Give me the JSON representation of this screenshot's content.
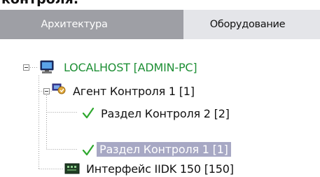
{
  "tabs": [
    {
      "label": "Архитектура",
      "active": false
    },
    {
      "label": "Оборудование",
      "active": true
    }
  ],
  "tree": {
    "root": {
      "label": "LOCALHOST [ADMIN-PC]",
      "icon": "computer-icon",
      "expanded": true
    },
    "agent": {
      "label": "Агент Контроля 1 [1]",
      "icon": "agent-icon",
      "expanded": true
    },
    "section2": {
      "label": "Раздел Контроля 2 [2]",
      "icon": "checkmark-icon"
    },
    "section1": {
      "label": "Раздел Контроля 1 [1]",
      "icon": "checkmark-icon",
      "selected": true
    },
    "interface": {
      "label": "Интерфейс IIDK 150 [150]",
      "icon": "interface-icon"
    }
  },
  "colors": {
    "tab_inactive_bg": "#9e9fa5",
    "tab_active_bg": "#e4e5e9",
    "root_text": "#1e8f35",
    "selection_bg": "#a7a8c4",
    "check": "#2fa82f"
  }
}
